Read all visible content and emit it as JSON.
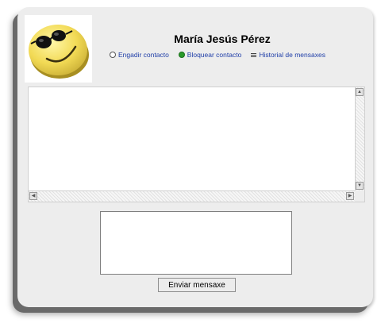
{
  "contact": {
    "name": "María Jesús Pérez",
    "avatar_icon": "sunglasses-smiley-icon"
  },
  "actions": [
    {
      "label": "Engadir contacto",
      "icon": "add-contact-icon"
    },
    {
      "label": "Bloquear contacto",
      "icon": "block-contact-icon"
    },
    {
      "label": "Historial de mensaxes",
      "icon": "message-history-icon"
    }
  ],
  "message": {
    "value": "",
    "send_label": "Enviar mensaxe"
  },
  "colors": {
    "link": "#1f3ea8",
    "block_icon": "#2a9a2a",
    "window_bg": "#ededed"
  }
}
